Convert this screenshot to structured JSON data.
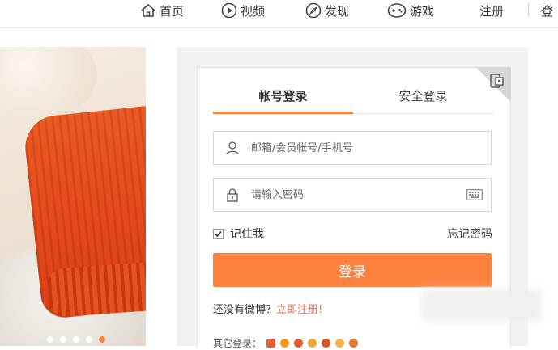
{
  "nav": {
    "items": [
      {
        "label": "首页",
        "icon": "home-icon"
      },
      {
        "label": "视频",
        "icon": "play-icon"
      },
      {
        "label": "发现",
        "icon": "compass-icon"
      },
      {
        "label": "游戏",
        "icon": "gamepad-icon"
      }
    ],
    "register": "注册",
    "login_partial": "登"
  },
  "carousel": {
    "slide_count": 5,
    "active_index": 4,
    "active_color": "#ff8140"
  },
  "login": {
    "tab_account": "帐号登录",
    "tab_secure": "安全登录",
    "username_placeholder": "邮箱/会员帐号/手机号",
    "password_placeholder": "请输入密码",
    "remember": "记住我",
    "forgot": "忘记密码",
    "submit": "登录",
    "no_account": "还没有微博？",
    "register_now": "立即注册!",
    "other_login": "其它登录："
  },
  "colors": {
    "accent": "#ff8140",
    "link": "#eb7350"
  }
}
